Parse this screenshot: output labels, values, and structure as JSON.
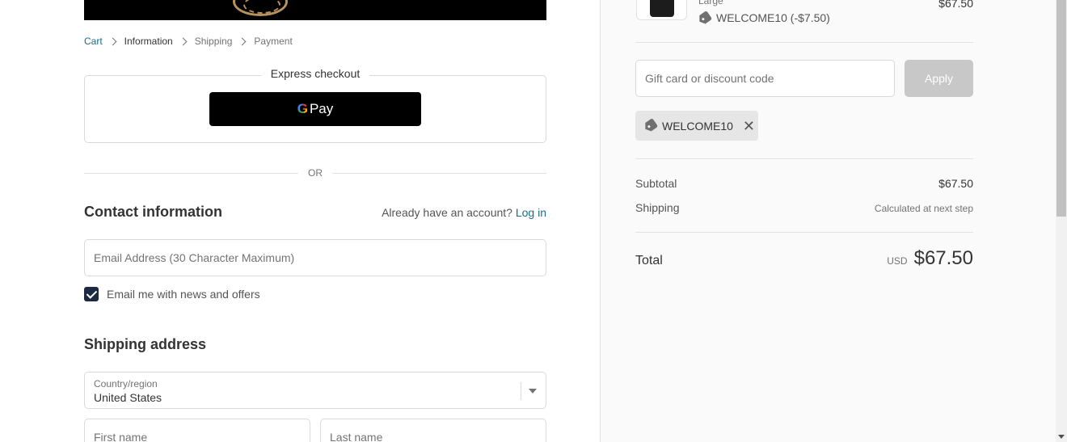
{
  "breadcrumbs": [
    "Cart",
    "Information",
    "Shipping",
    "Payment"
  ],
  "express": {
    "title": "Express checkout",
    "gpay_label": "Pay",
    "gpay_g": "G"
  },
  "or_label": "OR",
  "contact": {
    "heading": "Contact information",
    "account_prompt": "Already have an account?",
    "login_label": "Log in",
    "email_placeholder": "Email Address (30 Character Maximum)",
    "newsletter_label": "Email me with news and offers",
    "newsletter_checked": true
  },
  "shipping": {
    "heading": "Shipping address",
    "country_label": "Country/region",
    "country_value": "United States",
    "first_name_placeholder": "First name",
    "last_name_placeholder": "Last name"
  },
  "order": {
    "item_variant": "Large",
    "item_discount": "WELCOME10 (-$7.50)",
    "item_price": "$67.50"
  },
  "discount": {
    "placeholder": "Gift card or discount code",
    "apply_label": "Apply",
    "applied_code": "WELCOME10",
    "remove_glyph": "✕"
  },
  "summary": {
    "subtotal_label": "Subtotal",
    "subtotal_value": "$67.50",
    "shipping_label": "Shipping",
    "shipping_value": "Calculated at next step",
    "total_label": "Total",
    "total_currency": "USD",
    "total_value": "$67.50"
  },
  "colors": {
    "link": "#1a6f85",
    "checkbox": "#1b2a41",
    "apply_disabled": "#c8c8c8"
  }
}
